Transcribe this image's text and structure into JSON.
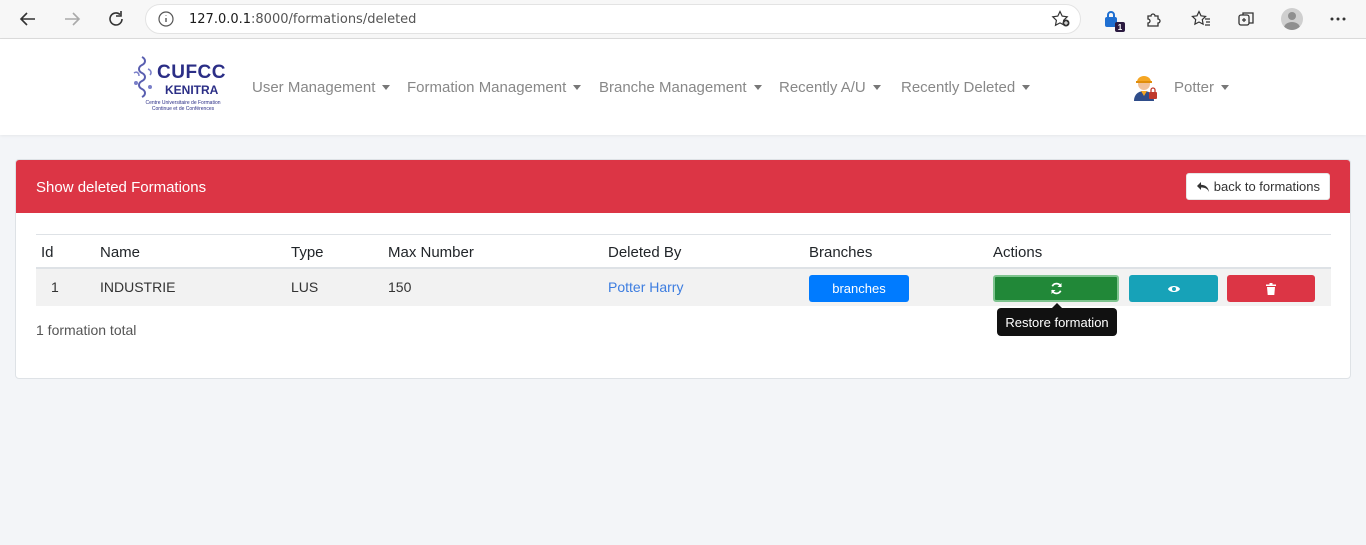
{
  "browser": {
    "url_host": "127.0.0.1",
    "url_rest": ":8000/formations/deleted",
    "extension_badge": "1"
  },
  "navbar": {
    "logo_title": "CUFCC",
    "logo_sub": "KENITRA",
    "logo_tiny": "Centre Universitaire de Formation Continue et de Conférences",
    "menus": [
      {
        "label": "User Management"
      },
      {
        "label": "Formation Management"
      },
      {
        "label": "Branche Management"
      },
      {
        "label": "Recently A/U"
      },
      {
        "label": "Recently Deleted"
      }
    ],
    "user": "Potter"
  },
  "card": {
    "title": "Show deleted Formations",
    "back_label": "back to formations"
  },
  "table": {
    "headers": [
      "Id",
      "Name",
      "Type",
      "Max Number",
      "Deleted By",
      "Branches",
      "Actions"
    ],
    "rows": [
      {
        "id": "1",
        "name": "INDUSTRIE",
        "type": "LUS",
        "max": "150",
        "deleted_by": "Potter Harry",
        "branches_label": "branches"
      }
    ]
  },
  "tooltip": "Restore formation",
  "total": "1 formation total",
  "colors": {
    "header_red": "#dc3545",
    "restore_green": "#218838",
    "view_teal": "#17a2b8",
    "branches_blue": "#007bff"
  }
}
